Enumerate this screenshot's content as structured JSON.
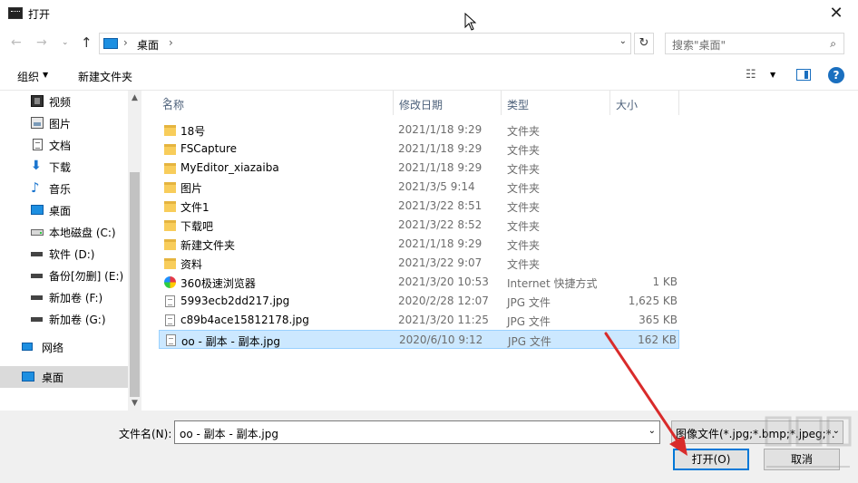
{
  "window": {
    "title": "打开",
    "close_glyph": "✕"
  },
  "address": {
    "back": "←",
    "forward": "→",
    "recent": "⌄",
    "up": "↑",
    "sep": "›",
    "path": "桌面",
    "drop": "⌄",
    "refresh": "↻",
    "search_placeholder": "搜索\"桌面\"",
    "search_glyph": "⌕"
  },
  "toolbar": {
    "organize": "组织",
    "organize_arrow": "▼",
    "new_folder": "新建文件夹",
    "view_glyph": "☷",
    "view_arrow": "▼",
    "help": "?"
  },
  "nav": {
    "scroll_up": "▲",
    "scroll_down": "▼",
    "items": [
      {
        "label": "视频"
      },
      {
        "label": "图片"
      },
      {
        "label": "文档"
      },
      {
        "label": "下载",
        "glyph": "⬇"
      },
      {
        "label": "音乐",
        "glyph": "♪"
      },
      {
        "label": "桌面"
      },
      {
        "label": "本地磁盘 (C:)"
      },
      {
        "label": "软件 (D:)"
      },
      {
        "label": "备份[勿删] (E:)"
      },
      {
        "label": "新加卷 (F:)"
      },
      {
        "label": "新加卷 (G:)"
      },
      {
        "label": "网络"
      },
      {
        "label": "桌面"
      }
    ]
  },
  "columns": {
    "name": "名称",
    "date": "修改日期",
    "type": "类型",
    "size": "大小",
    "sort": "^"
  },
  "files": [
    {
      "name": "18号",
      "date": "2021/1/18 9:29",
      "type": "文件夹",
      "size": ""
    },
    {
      "name": "FSCapture",
      "date": "2021/1/18 9:29",
      "type": "文件夹",
      "size": ""
    },
    {
      "name": "MyEditor_xiazaiba",
      "date": "2021/1/18 9:29",
      "type": "文件夹",
      "size": ""
    },
    {
      "name": "图片",
      "date": "2021/3/5 9:14",
      "type": "文件夹",
      "size": ""
    },
    {
      "name": "文件1",
      "date": "2021/3/22 8:51",
      "type": "文件夹",
      "size": ""
    },
    {
      "name": "下载吧",
      "date": "2021/3/22 8:52",
      "type": "文件夹",
      "size": ""
    },
    {
      "name": "新建文件夹",
      "date": "2021/1/18 9:29",
      "type": "文件夹",
      "size": ""
    },
    {
      "name": "资料",
      "date": "2021/3/22 9:07",
      "type": "文件夹",
      "size": ""
    },
    {
      "name": "360极速浏览器",
      "date": "2021/3/20 10:53",
      "type": "Internet 快捷方式",
      "size": "1 KB"
    },
    {
      "name": "5993ecb2dd217.jpg",
      "date": "2020/2/28 12:07",
      "type": "JPG 文件",
      "size": "1,625 KB"
    },
    {
      "name": "c89b4ace15812178.jpg",
      "date": "2021/3/20 11:25",
      "type": "JPG 文件",
      "size": "365 KB"
    },
    {
      "name": "oo - 副本 - 副本.jpg",
      "date": "2020/6/10 9:12",
      "type": "JPG 文件",
      "size": "162 KB"
    }
  ],
  "bottom": {
    "filename_label": "文件名(N):",
    "filename_value": "oo - 副本 - 副本.jpg",
    "filename_drop": "⌄",
    "filetype_value": "图像文件(*.jpg;*.bmp;*.jpeg;*.",
    "filetype_drop": "⌄",
    "open_button": "打开(O)",
    "cancel_button": "取消"
  }
}
